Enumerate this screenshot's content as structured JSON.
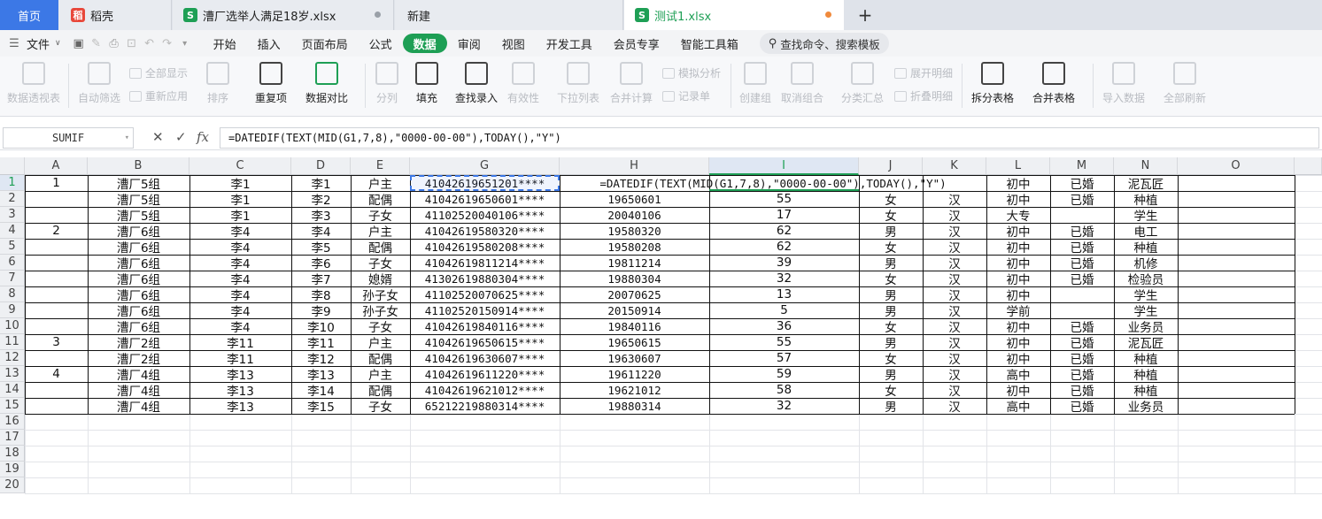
{
  "tabs": {
    "home": "首页",
    "daoke": "稻壳",
    "file1": "漕厂选举人满足18岁.xlsx",
    "new": "新建",
    "active": "测试1.xlsx",
    "add": "+"
  },
  "menu": {
    "file": "文件",
    "items": [
      "开始",
      "插入",
      "页面布局",
      "公式",
      "数据",
      "审阅",
      "视图",
      "开发工具",
      "会员专享",
      "智能工具箱"
    ],
    "active": "数据",
    "search": "查找命令、搜索模板"
  },
  "ribbon": {
    "pivot": "数据透视表",
    "autofilter": "自动筛选",
    "show_all": "全部显示",
    "reapply": "重新应用",
    "sort": "排序",
    "dup": "重复项",
    "compare": "数据对比",
    "split": "分列",
    "fill": "填充",
    "lookup": "查找录入",
    "validity": "有效性",
    "dropdown": "下拉列表",
    "merge_calc": "合并计算",
    "simulate": "模拟分析",
    "record": "记录单",
    "create_group": "创建组",
    "ungroup": "取消组合",
    "subtotal": "分类汇总",
    "expand": "展开明细",
    "collapse": "折叠明细",
    "split_table": "拆分表格",
    "merge_table": "合并表格",
    "import": "导入数据",
    "refresh_all": "全部刷新"
  },
  "formula_bar": {
    "name_box": "SUMIF",
    "formula": "=DATEDIF(TEXT(MID(G1,7,8),\"0000-00-00\"),TODAY(),\"Y\")"
  },
  "columns": [
    "A",
    "B",
    "C",
    "D",
    "E",
    "G",
    "H",
    "I",
    "J",
    "K",
    "L",
    "M",
    "N",
    "O"
  ],
  "row_numbers": [
    "1",
    "2",
    "3",
    "4",
    "5",
    "6",
    "7",
    "8",
    "9",
    "10",
    "11",
    "12",
    "13",
    "14",
    "15",
    "16",
    "17",
    "18",
    "19",
    "20"
  ],
  "rows": [
    [
      "1",
      "漕厂5组",
      "李1",
      "李1",
      "户主",
      "41042619651201****",
      "=DATEDIF(TEXT(MID(G1,7,8),\"0000-00-00\"),TODAY(),\"Y\")",
      "",
      "",
      "",
      "初中",
      "已婚",
      "泥瓦匠"
    ],
    [
      "",
      "漕厂5组",
      "李1",
      "李2",
      "配偶",
      "41042619650601****",
      "19650601",
      "55",
      "女",
      "汉",
      "初中",
      "已婚",
      "种植"
    ],
    [
      "",
      "漕厂5组",
      "李1",
      "李3",
      "子女",
      "41102520040106****",
      "20040106",
      "17",
      "女",
      "汉",
      "大专",
      "",
      "学生"
    ],
    [
      "2",
      "漕厂6组",
      "李4",
      "李4",
      "户主",
      "41042619580320****",
      "19580320",
      "62",
      "男",
      "汉",
      "初中",
      "已婚",
      "电工"
    ],
    [
      "",
      "漕厂6组",
      "李4",
      "李5",
      "配偶",
      "41042619580208****",
      "19580208",
      "62",
      "女",
      "汉",
      "初中",
      "已婚",
      "种植"
    ],
    [
      "",
      "漕厂6组",
      "李4",
      "李6",
      "子女",
      "41042619811214****",
      "19811214",
      "39",
      "男",
      "汉",
      "初中",
      "已婚",
      "机修"
    ],
    [
      "",
      "漕厂6组",
      "李4",
      "李7",
      "媳婿",
      "41302619880304****",
      "19880304",
      "32",
      "女",
      "汉",
      "初中",
      "已婚",
      "检验员"
    ],
    [
      "",
      "漕厂6组",
      "李4",
      "李8",
      "孙子女",
      "41102520070625****",
      "20070625",
      "13",
      "男",
      "汉",
      "初中",
      "",
      "学生"
    ],
    [
      "",
      "漕厂6组",
      "李4",
      "李9",
      "孙子女",
      "41102520150914****",
      "20150914",
      "5",
      "男",
      "汉",
      "学前",
      "",
      "学生"
    ],
    [
      "",
      "漕厂6组",
      "李4",
      "李10",
      "子女",
      "41042619840116****",
      "19840116",
      "36",
      "女",
      "汉",
      "初中",
      "已婚",
      "业务员"
    ],
    [
      "3",
      "漕厂2组",
      "李11",
      "李11",
      "户主",
      "41042619650615****",
      "19650615",
      "55",
      "男",
      "汉",
      "初中",
      "已婚",
      "泥瓦匠"
    ],
    [
      "",
      "漕厂2组",
      "李11",
      "李12",
      "配偶",
      "41042619630607****",
      "19630607",
      "57",
      "女",
      "汉",
      "初中",
      "已婚",
      "种植"
    ],
    [
      "4",
      "漕厂4组",
      "李13",
      "李13",
      "户主",
      "41042619611220****",
      "19611220",
      "59",
      "男",
      "汉",
      "高中",
      "已婚",
      "种植"
    ],
    [
      "",
      "漕厂4组",
      "李13",
      "李14",
      "配偶",
      "41042619621012****",
      "19621012",
      "58",
      "女",
      "汉",
      "初中",
      "已婚",
      "种植"
    ],
    [
      "",
      "漕厂4组",
      "李13",
      "李15",
      "子女",
      "65212219880314****",
      "19880314",
      "32",
      "男",
      "汉",
      "高中",
      "已婚",
      "业务员"
    ]
  ],
  "colors": {
    "accent": "#1e9f55",
    "home_tab": "#3c78e6"
  }
}
